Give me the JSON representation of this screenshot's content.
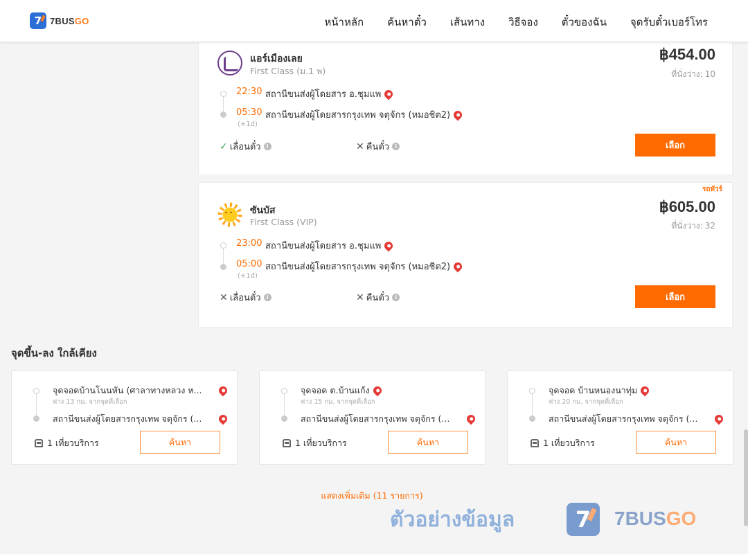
{
  "header": {
    "logo_mark": "7",
    "logo_text_1": "7BUS",
    "logo_text_2": "GO",
    "nav": [
      "หน้าหลัก",
      "ค้นหาตั๋ว",
      "เส้นทาง",
      "วิธีจอง",
      "ตั๋วของฉัน",
      "จุดรับตั๋วเบอร์โทร"
    ]
  },
  "trips": [
    {
      "operator": "แอร์เมืองเลย",
      "class": "First Class (ม.1 พ)",
      "price": "฿454.00",
      "seats_label": "ที่นั่งว่าง:",
      "seats": "10",
      "depart_time": "22:30",
      "depart_stop": "สถานีขนส่งผู้โดยสาร อ.ชุมแพ",
      "arrive_time": "05:30",
      "arrive_stop": "สถานีขนส่งผู้โดยสารกรุงเทพ จตุจักร (หมอชิต2)",
      "plus_day": "(+1d)",
      "reschedule": "เลื่อนตั๋ว",
      "refund": "คืนตั๋ว",
      "select_label": "เลือก"
    },
    {
      "tag": "รถทัวร์",
      "operator": "ซันบัส",
      "class": "First Class (VIP)",
      "price": "฿605.00",
      "seats_label": "ที่นั่งว่าง:",
      "seats": "32",
      "depart_time": "23:00",
      "depart_stop": "สถานีขนส่งผู้โดยสาร อ.ชุมแพ",
      "arrive_time": "05:00",
      "arrive_stop": "สถานีขนส่งผู้โดยสารกรุงเทพ จตุจักร (หมอชิต2)",
      "plus_day": "(+1d)",
      "reschedule": "เลื่อนตั๋ว",
      "refund": "คืนตั๋ว",
      "select_label": "เลือก"
    }
  ],
  "nearby": {
    "title": "จุดขึ้น-ลง ใกล้เคียง",
    "items": [
      {
        "from": "จุดจอดบ้านโนนหัน (ศาลาทางหลวง ห...",
        "distance": "ห่าง 13 กม. จากจุดที่เลือก",
        "to": "สถานีขนส่งผู้โดยสารกรุงเทพ จตุจักร (...",
        "service": "1 เที่ยวบริการ",
        "search_label": "ค้นหา"
      },
      {
        "from": "จุดจอด ต.บ้านแก้ง",
        "distance": "ห่าง 15 กม. จากจุดที่เลือก",
        "to": "สถานีขนส่งผู้โดยสารกรุงเทพ จตุจักร (...",
        "service": "1 เที่ยวบริการ",
        "search_label": "ค้นหา"
      },
      {
        "from": "จุดจอด บ้านหนองนาทุ่ม",
        "distance": "ห่าง 20 กม. จากจุดที่เลือก",
        "to": "สถานีขนส่งผู้โดยสารกรุงเทพ จตุจักร (...",
        "service": "1 เที่ยวบริการ",
        "search_label": "ค้นหา"
      }
    ],
    "show_more": "แสดงเพิ่มเติม (11 รายการ)"
  },
  "watermark": {
    "text": "ตัวอย่างข้อมูล",
    "logo_mark": "7",
    "brand_1": "7BUS",
    "brand_2": "GO"
  }
}
